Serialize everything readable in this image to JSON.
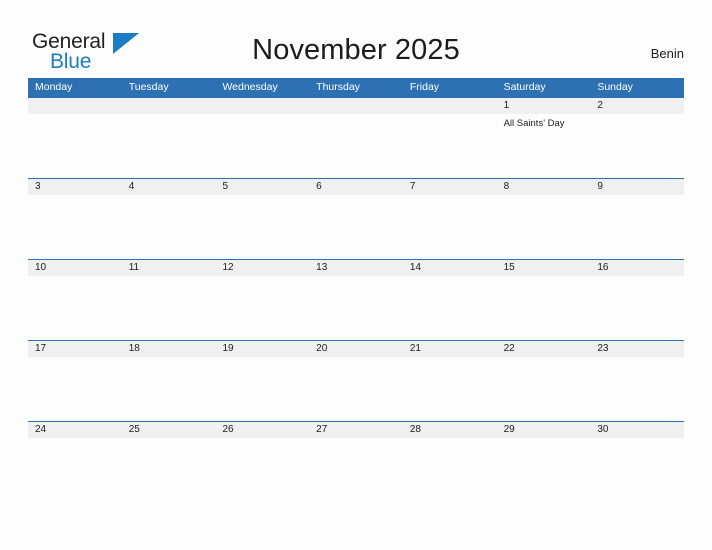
{
  "brand": {
    "name_part1": "General",
    "name_part2": "Blue",
    "flag_icon": "flag-triangle-icon",
    "accent_color": "#1d7cc4"
  },
  "header": {
    "title": "November 2025",
    "country": "Benin"
  },
  "theme": {
    "header_band": "#2e71b3",
    "date_band": "#f0f0f0",
    "cell_background": "#fdfdfd",
    "text": "#1c1c1c",
    "page_background": "#fdfdfd"
  },
  "calendar": {
    "weekdays": [
      "Monday",
      "Tuesday",
      "Wednesday",
      "Thursday",
      "Friday",
      "Saturday",
      "Sunday"
    ],
    "weeks": [
      {
        "days": [
          {
            "date": "",
            "events": []
          },
          {
            "date": "",
            "events": []
          },
          {
            "date": "",
            "events": []
          },
          {
            "date": "",
            "events": []
          },
          {
            "date": "",
            "events": []
          },
          {
            "date": "1",
            "events": [
              "All Saints' Day"
            ]
          },
          {
            "date": "2",
            "events": []
          }
        ]
      },
      {
        "days": [
          {
            "date": "3",
            "events": []
          },
          {
            "date": "4",
            "events": []
          },
          {
            "date": "5",
            "events": []
          },
          {
            "date": "6",
            "events": []
          },
          {
            "date": "7",
            "events": []
          },
          {
            "date": "8",
            "events": []
          },
          {
            "date": "9",
            "events": []
          }
        ]
      },
      {
        "days": [
          {
            "date": "10",
            "events": []
          },
          {
            "date": "11",
            "events": []
          },
          {
            "date": "12",
            "events": []
          },
          {
            "date": "13",
            "events": []
          },
          {
            "date": "14",
            "events": []
          },
          {
            "date": "15",
            "events": []
          },
          {
            "date": "16",
            "events": []
          }
        ]
      },
      {
        "days": [
          {
            "date": "17",
            "events": []
          },
          {
            "date": "18",
            "events": []
          },
          {
            "date": "19",
            "events": []
          },
          {
            "date": "20",
            "events": []
          },
          {
            "date": "21",
            "events": []
          },
          {
            "date": "22",
            "events": []
          },
          {
            "date": "23",
            "events": []
          }
        ]
      },
      {
        "days": [
          {
            "date": "24",
            "events": []
          },
          {
            "date": "25",
            "events": []
          },
          {
            "date": "26",
            "events": []
          },
          {
            "date": "27",
            "events": []
          },
          {
            "date": "28",
            "events": []
          },
          {
            "date": "29",
            "events": []
          },
          {
            "date": "30",
            "events": []
          }
        ]
      }
    ]
  }
}
